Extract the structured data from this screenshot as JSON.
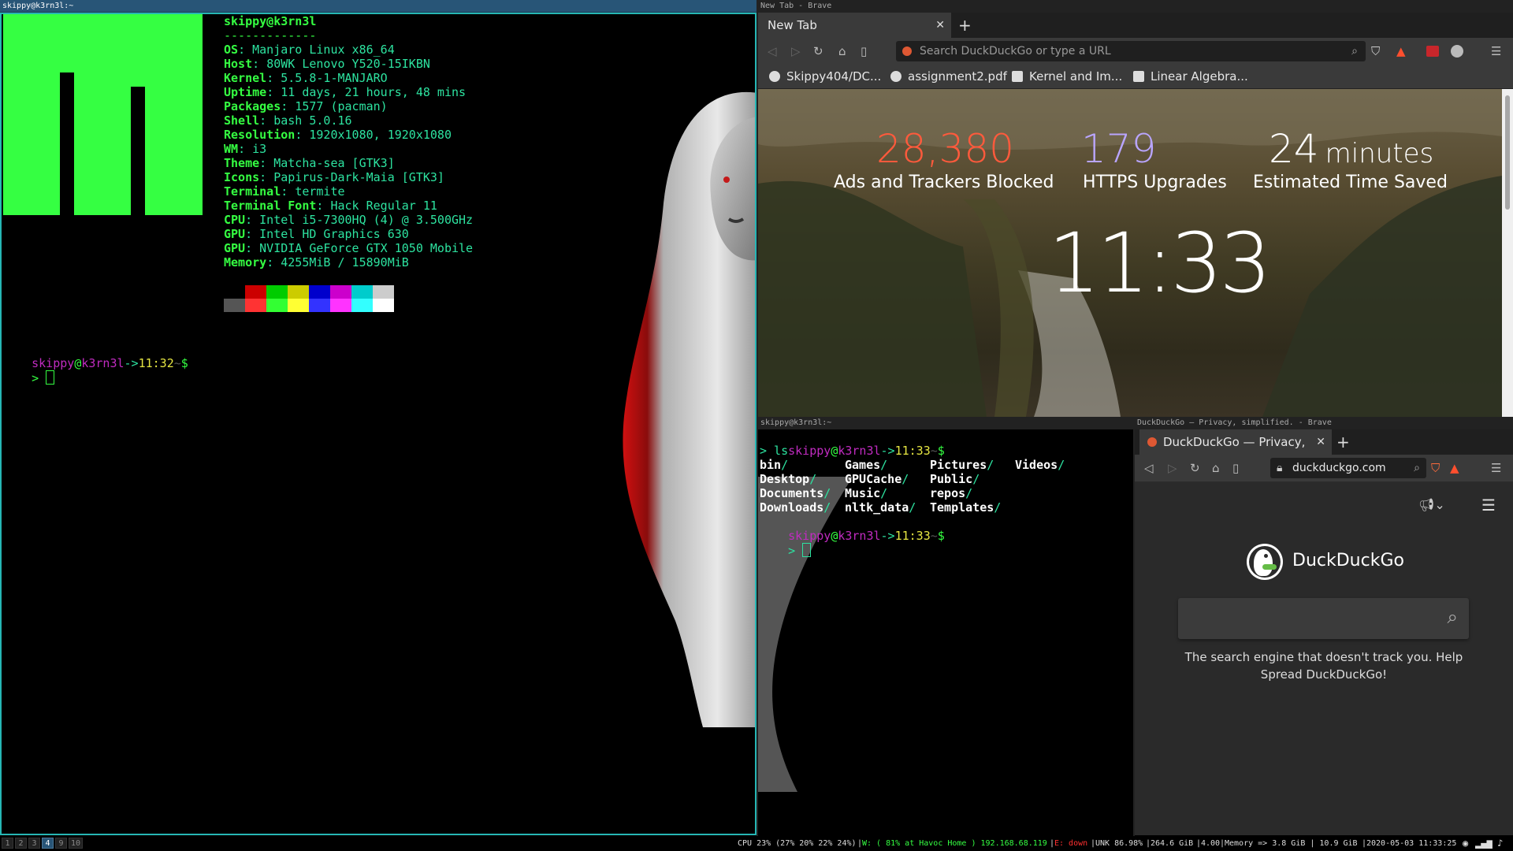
{
  "colors": {
    "terminal_green": "#35ff42",
    "terminal_teal": "#2de3a0",
    "prompt_magenta": "#c02bc0",
    "prompt_yellow": "#e6e642",
    "focused_border": "#26b6b4",
    "stat_ads": "#ff5a3c",
    "stat_https": "#b9a5ff"
  },
  "left_window": {
    "title": "skippy@k3rn3l:~",
    "neofetch": {
      "userhost": "skippy@k3rn3l",
      "separator": "-------------",
      "rows": [
        {
          "key": "OS",
          "value": "Manjaro Linux x86_64"
        },
        {
          "key": "Host",
          "value": "80WK Lenovo Y520-15IKBN"
        },
        {
          "key": "Kernel",
          "value": "5.5.8-1-MANJARO"
        },
        {
          "key": "Uptime",
          "value": "11 days, 21 hours, 48 mins"
        },
        {
          "key": "Packages",
          "value": "1577 (pacman)"
        },
        {
          "key": "Shell",
          "value": "bash 5.0.16"
        },
        {
          "key": "Resolution",
          "value": "1920x1080, 1920x1080"
        },
        {
          "key": "WM",
          "value": "i3"
        },
        {
          "key": "Theme",
          "value": "Matcha-sea [GTK3]"
        },
        {
          "key": "Icons",
          "value": "Papirus-Dark-Maia [GTK3]"
        },
        {
          "key": "Terminal",
          "value": "termite"
        },
        {
          "key": "Terminal Font",
          "value": "Hack Regular 11"
        },
        {
          "key": "CPU",
          "value": "Intel i5-7300HQ (4) @ 3.500GHz"
        },
        {
          "key": "GPU",
          "value": "Intel HD Graphics 630"
        },
        {
          "key": "GPU",
          "value": "NVIDIA GeForce GTX 1050 Mobile"
        },
        {
          "key": "Memory",
          "value": "4255MiB / 15890MiB"
        }
      ],
      "palette_top": [
        "#000000",
        "#cc0000",
        "#00cc00",
        "#cccc00",
        "#0000cc",
        "#cc00cc",
        "#00cccc",
        "#cccccc"
      ],
      "palette_bottom": [
        "#555555",
        "#ff3333",
        "#33ff33",
        "#ffff33",
        "#3333ff",
        "#ff33ff",
        "#33ffff",
        "#ffffff"
      ]
    },
    "prompt": {
      "user": "skippy",
      "at": "@",
      "host": "k3rn3l",
      "arrow": "->",
      "time": "11:32",
      "tilde": "~",
      "dollar": "$",
      "caret": ">"
    }
  },
  "brave_top": {
    "title": "New Tab - Brave",
    "tab_label": "New Tab",
    "tab_close": "✕",
    "new_tab": "+",
    "url_placeholder": "Search DuckDuckGo or type a URL",
    "bookmarks": [
      "Skippy404/DC...",
      "assignment2.pdf",
      "Kernel and Im...",
      "Linear Algebra..."
    ],
    "stats": [
      {
        "value": "28,380",
        "label": "Ads and Trackers Blocked"
      },
      {
        "value": "179",
        "label": "HTTPS Upgrades"
      },
      {
        "value": "24",
        "unit": "minutes",
        "label": "Estimated Time Saved"
      }
    ],
    "clock": "11:33"
  },
  "mid_terminal": {
    "title": "skippy@k3rn3l:~",
    "prompt1": {
      "user": "skippy",
      "at": "@",
      "host": "k3rn3l",
      "arrow": "->",
      "time": "11:33",
      "tilde": "~",
      "dollar": "$"
    },
    "command": "> ls",
    "ls_columns": [
      [
        "bin",
        "Desktop",
        "Documents",
        "Downloads"
      ],
      [
        "Games",
        "GPUCache",
        "Music",
        "nltk_data"
      ],
      [
        "Pictures",
        "Public",
        "repos",
        "Templates"
      ],
      [
        "Videos"
      ]
    ],
    "ls_slash": "/",
    "prompt2": {
      "user": "skippy",
      "at": "@",
      "host": "k3rn3l",
      "arrow": "->",
      "time": "11:33",
      "tilde": "~",
      "dollar": "$"
    },
    "caret": ">"
  },
  "brave_bottom": {
    "title": "DuckDuckGo — Privacy, simplified. - Brave",
    "tab_label": "DuckDuckGo — Privacy, sim",
    "tab_close": "✕",
    "new_tab": "+",
    "url": "duckduckgo.com",
    "brand": "DuckDuckGo",
    "tagline": "The search engine that doesn't track you. Help Spread DuckDuckGo!"
  },
  "i3bar": {
    "workspaces": [
      "1",
      "2",
      "3",
      "4",
      "9",
      "10"
    ],
    "active_workspace": "4",
    "status": {
      "cpu": "CPU 23% (27% 20% 22% 24%)",
      "wifi": "W: ( 81% at Havoc Home ) 192.168.68.119",
      "eth": "E: down",
      "unk": "UNK 86.98%",
      "disk": "264.6 GiB",
      "load": "4.00",
      "memory": "Memory => 3.8 GiB | 10.9 GiB",
      "datetime": "2020-05-03 11:33:25"
    }
  }
}
